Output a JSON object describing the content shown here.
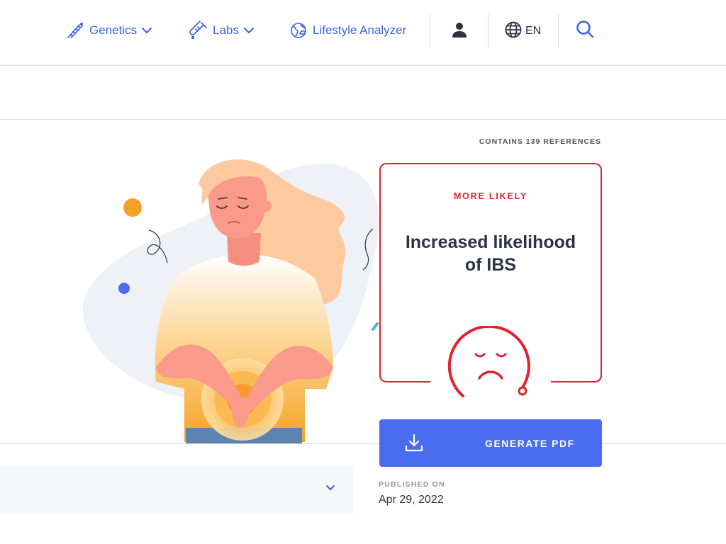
{
  "nav": {
    "genetics_label": "Genetics",
    "labs_label": "Labs",
    "lifestyle_label": "Lifestyle Analyzer",
    "language_label": "EN"
  },
  "article": {
    "references_text": "CONTAINS 139 REFERENCES",
    "result_tag": "MORE LIKELY",
    "result_title": "Increased likelihood of IBS",
    "generate_pdf_label": "GENERATE PDF",
    "published_label": "PUBLISHED ON",
    "published_date": "Apr 29, 2022"
  },
  "colors": {
    "nav_accent": "#3d63dd",
    "alert_red": "#e0222f",
    "button_blue": "#4a6cf0"
  },
  "icons": {
    "genetics": "dna-icon",
    "labs": "test-tube-icon",
    "lifestyle": "globe-leaf-icon",
    "account": "user-icon",
    "language": "globe-icon",
    "search": "search-icon",
    "pdf": "download-icon",
    "result": "sad-face-icon"
  }
}
